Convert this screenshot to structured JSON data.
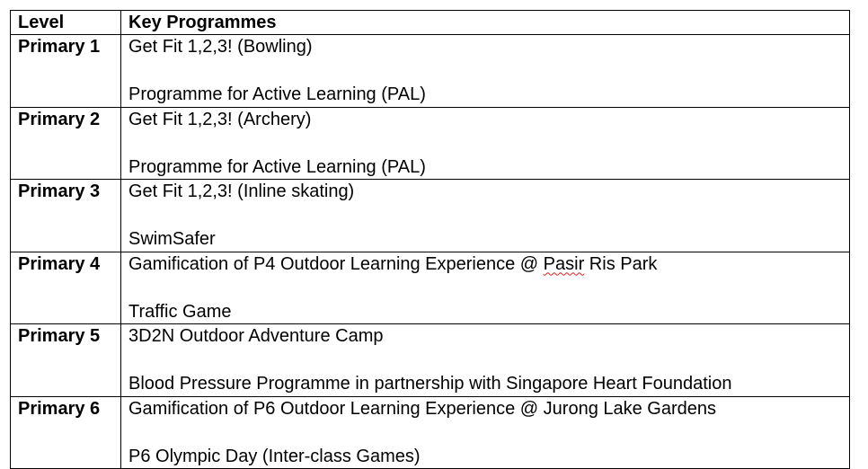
{
  "table": {
    "headers": {
      "level": "Level",
      "programmes": "Key Programmes"
    },
    "rows": [
      {
        "level": "Primary 1",
        "programme_1": "Get Fit 1,2,3! (Bowling)",
        "programme_2": "Programme for Active Learning (PAL)"
      },
      {
        "level": "Primary 2",
        "programme_1": "Get Fit 1,2,3! (Archery)",
        "programme_2": "Programme for Active Learning (PAL)"
      },
      {
        "level": "Primary 3",
        "programme_1": "Get Fit 1,2,3! (Inline skating)",
        "programme_2": "SwimSafer"
      },
      {
        "level": "Primary 4",
        "programme_1_before": "Gamification of P4 Outdoor Learning Experience @ ",
        "programme_1_flagged": "Pasir",
        "programme_1_after": " Ris Park",
        "programme_2": "Traffic Game"
      },
      {
        "level": "Primary 5",
        "programme_1": "3D2N Outdoor Adventure Camp",
        "programme_2": "Blood Pressure Programme in partnership with Singapore Heart Foundation"
      },
      {
        "level": "Primary 6",
        "programme_1": "Gamification of P6 Outdoor Learning Experience @ Jurong Lake Gardens",
        "programme_2": "P6 Olympic Day (Inter-class Games)"
      }
    ]
  },
  "colors": {
    "border": "#000000",
    "text": "#000000",
    "spellcheck_underline": "#e02020"
  }
}
